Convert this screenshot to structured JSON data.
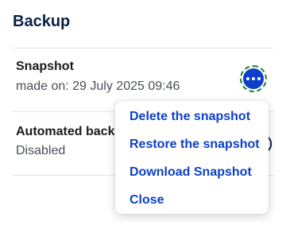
{
  "section": {
    "title": "Backup"
  },
  "snapshot": {
    "title": "Snapshot",
    "made_on": "made on: 29 July 2025 09:46"
  },
  "automated": {
    "title": "Automated back",
    "status": "Disabled"
  },
  "more_button": {
    "icon": "ellipsis-icon",
    "color": "#0d3fc7",
    "focus_ring_color": "#1e7a3a"
  },
  "menu": {
    "items": [
      {
        "label": "Delete the snapshot"
      },
      {
        "label": "Restore the snapshot"
      },
      {
        "label": "Download Snapshot"
      },
      {
        "label": "Close"
      }
    ]
  },
  "colors": {
    "accent": "#0d3fc7",
    "heading": "#0b1f47"
  }
}
